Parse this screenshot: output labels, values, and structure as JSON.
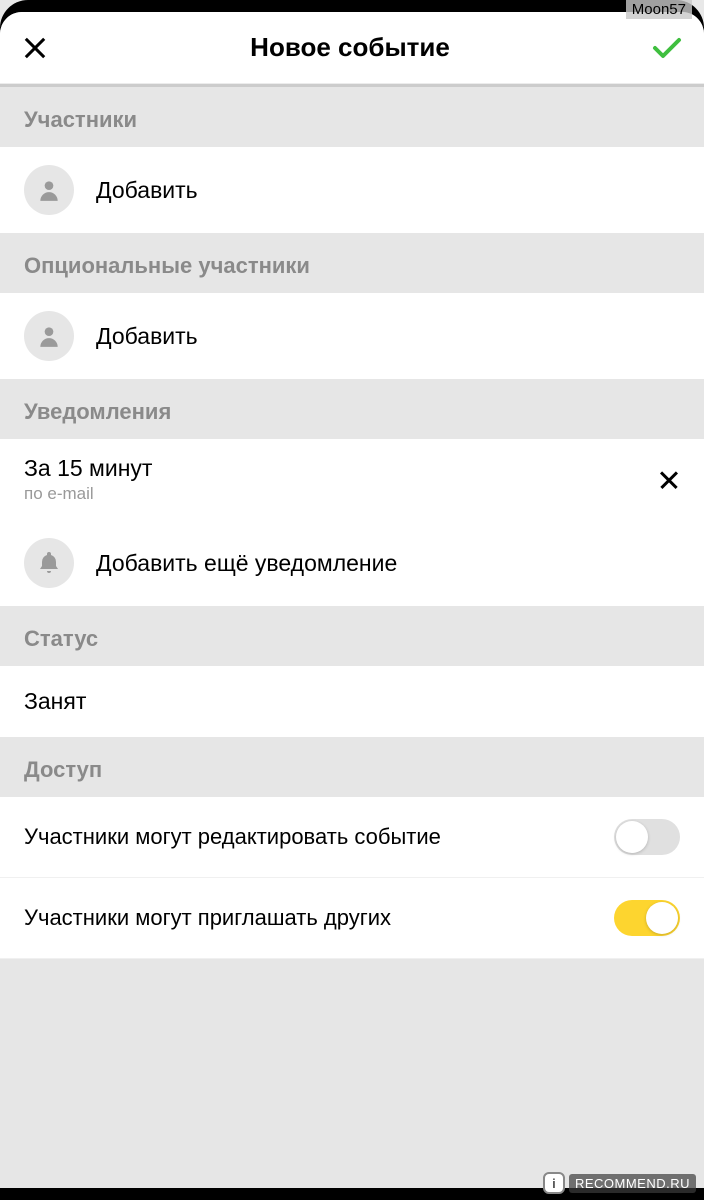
{
  "overlay": {
    "username": "Moon57"
  },
  "header": {
    "title": "Новое событие"
  },
  "sections": {
    "participants": {
      "title": "Участники",
      "add_label": "Добавить"
    },
    "optional": {
      "title": "Опциональные участники",
      "add_label": "Добавить"
    },
    "notifications": {
      "title": "Уведомления",
      "item": {
        "title": "За 15 минут",
        "subtitle": "по e-mail"
      },
      "add_more_label": "Добавить ещё уведомление"
    },
    "status": {
      "title": "Статус",
      "value": "Занят"
    },
    "access": {
      "title": "Доступ",
      "edit_label": "Участники могут редактировать событие",
      "edit_on": false,
      "invite_label": "Участники могут приглашать других",
      "invite_on": true
    }
  },
  "watermark": {
    "badge": "i",
    "text": "RECOMMEND.RU"
  }
}
